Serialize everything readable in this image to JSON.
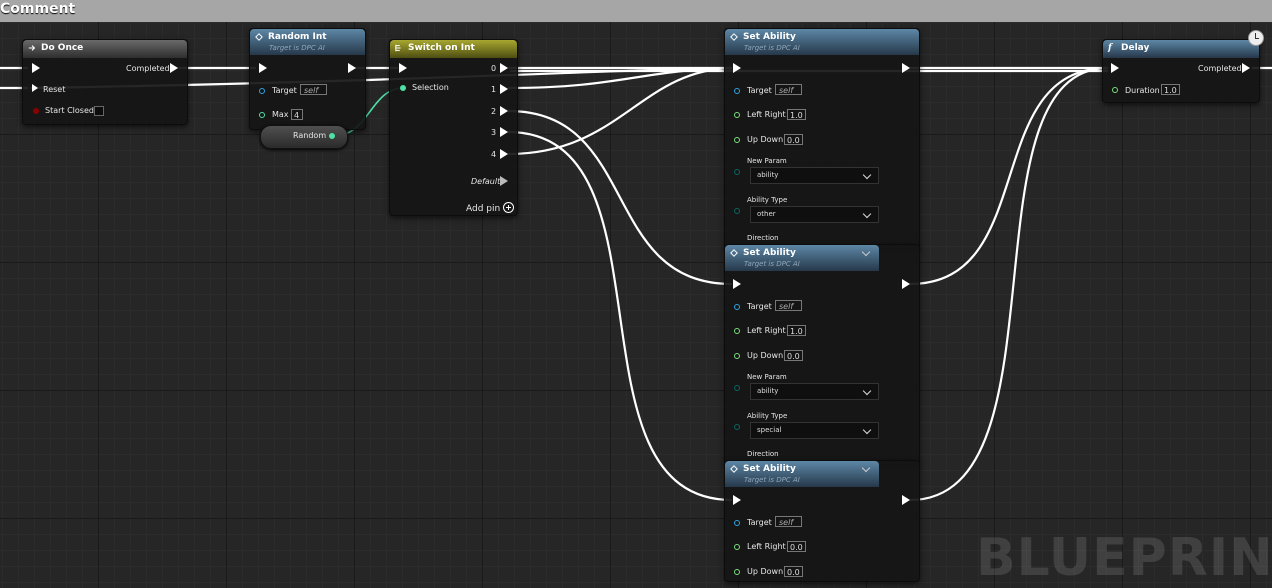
{
  "comment": {
    "title": "Comment"
  },
  "watermark": "BLUEPRINT",
  "colors": {
    "exec_wire": "#ffffff",
    "int_wire": "#4fe0a8",
    "comment_bar": "#a6a6a6"
  },
  "nodes": {
    "do_once": {
      "title": "Do Once",
      "out_completed": "Completed",
      "in_reset": "Reset",
      "in_start_closed": "Start Closed"
    },
    "random_int": {
      "title": "Random Int",
      "subtitle": "Target is DPC AI",
      "target_label": "Target",
      "target_value": "self",
      "max_label": "Max",
      "max_value": "4"
    },
    "random_reroute": {
      "label": "Random"
    },
    "switch_on_int": {
      "title": "Switch on Int",
      "selection_label": "Selection",
      "outputs": [
        "0",
        "1",
        "2",
        "3",
        "4"
      ],
      "default_label": "Default",
      "add_pin_label": "Add pin"
    },
    "set_ability_1": {
      "title": "Set Ability",
      "subtitle": "Target is DPC AI",
      "target_label": "Target",
      "target_value": "self",
      "left_right_label": "Left Right",
      "left_right_value": "1.0",
      "up_down_label": "Up Down",
      "up_down_value": "0.0",
      "new_param_label": "New Param",
      "new_param_value": "ability",
      "ability_type_label": "Ability Type",
      "ability_type_value": "other",
      "direction_label": "Direction"
    },
    "set_ability_2": {
      "title": "Set Ability",
      "subtitle": "Target is DPC AI",
      "target_label": "Target",
      "target_value": "self",
      "left_right_label": "Left Right",
      "left_right_value": "1.0",
      "up_down_label": "Up Down",
      "up_down_value": "0.0",
      "new_param_label": "New Param",
      "new_param_value": "ability",
      "ability_type_label": "Ability Type",
      "ability_type_value": "special",
      "direction_label": "Direction"
    },
    "set_ability_3": {
      "title": "Set Ability",
      "subtitle": "Target is DPC AI",
      "target_label": "Target",
      "target_value": "self",
      "left_right_label": "Left Right",
      "left_right_value": "0.0",
      "up_down_label": "Up Down",
      "up_down_value": "0.0"
    },
    "delay": {
      "title": "Delay",
      "out_completed": "Completed",
      "duration_label": "Duration",
      "duration_value": "1.0"
    }
  }
}
